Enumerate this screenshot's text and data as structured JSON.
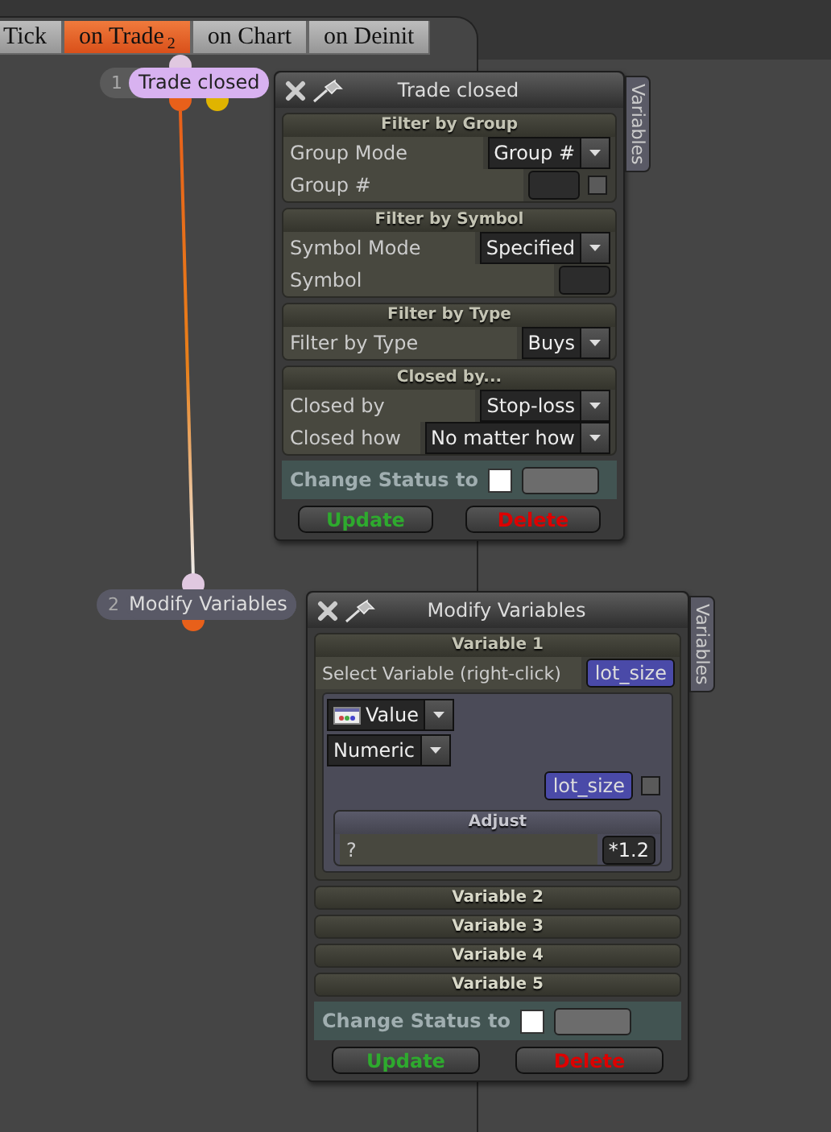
{
  "tabs": [
    {
      "label": "Tick",
      "selected": false
    },
    {
      "label": "on Trade",
      "badge": "2",
      "selected": true
    },
    {
      "label": "on Chart",
      "selected": false
    },
    {
      "label": "on Deinit",
      "selected": false
    }
  ],
  "nodes": [
    {
      "number": "1",
      "label": "Trade closed",
      "kind": "trigger"
    },
    {
      "number": "2",
      "label": "Modify Variables",
      "kind": "action"
    }
  ],
  "panels": [
    {
      "title": "Trade closed",
      "side_tab": "Variables",
      "sections": [
        {
          "title": "Filter by Group",
          "expanded": true,
          "rows": [
            {
              "kind": "select",
              "label": "Group Mode",
              "value": "Group #"
            },
            {
              "kind": "input",
              "label": "Group #",
              "checked": false
            }
          ]
        },
        {
          "title": "Filter by Symbol",
          "expanded": true,
          "rows": [
            {
              "kind": "select",
              "label": "Symbol Mode",
              "value": "Specified"
            },
            {
              "kind": "input",
              "label": "Symbol"
            }
          ]
        },
        {
          "title": "Filter by Type",
          "expanded": true,
          "rows": [
            {
              "kind": "select",
              "label": "Filter by Type",
              "value": "Buys"
            }
          ]
        },
        {
          "title": "Closed by...",
          "expanded": true,
          "rows": [
            {
              "kind": "select",
              "label": "Closed by",
              "value": "Stop-loss"
            },
            {
              "kind": "select",
              "label": "Closed how",
              "value": "No matter how"
            }
          ]
        }
      ],
      "status": {
        "label": "Change Status to",
        "checked": false
      },
      "buttons": [
        {
          "label": "Update",
          "kind": "update"
        },
        {
          "label": "Delete",
          "kind": "delete"
        }
      ]
    },
    {
      "title": "Modify Variables",
      "side_tab": "Variables",
      "sections": [
        {
          "title": "Variable 1",
          "expanded": true,
          "rows": [
            {
              "kind": "chip",
              "label": "Select Variable (right-click)",
              "value": "lot_size"
            },
            {
              "kind": "group",
              "rows": [
                {
                  "kind": "icon-select",
                  "value": "Value"
                },
                {
                  "kind": "select",
                  "value": "Numeric"
                },
                {
                  "kind": "chip",
                  "value": "lot_size",
                  "checked": false
                },
                {
                  "kind": "subsection",
                  "title": "Adjust",
                  "rows": [
                    {
                      "kind": "input",
                      "label": "?",
                      "value": "*1.2"
                    }
                  ]
                }
              ]
            }
          ]
        },
        {
          "title": "Variable 2",
          "expanded": false
        },
        {
          "title": "Variable 3",
          "expanded": false
        },
        {
          "title": "Variable 4",
          "expanded": false
        },
        {
          "title": "Variable 5",
          "expanded": false
        }
      ],
      "status": {
        "label": "Change Status to",
        "checked": false
      },
      "buttons": [
        {
          "label": "Update",
          "kind": "update"
        },
        {
          "label": "Delete",
          "kind": "delete"
        }
      ]
    }
  ]
}
